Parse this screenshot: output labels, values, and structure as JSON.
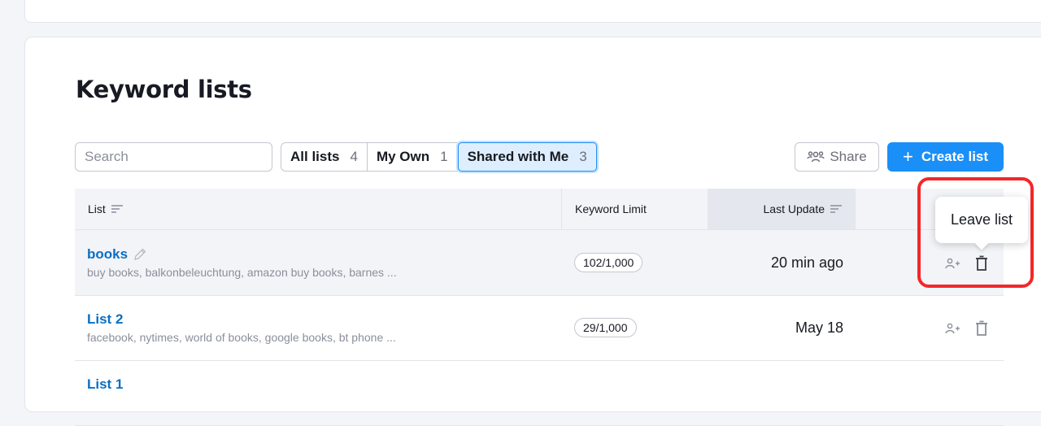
{
  "page": {
    "title": "Keyword lists"
  },
  "search": {
    "placeholder": "Search",
    "value": ""
  },
  "tabs": [
    {
      "label": "All lists",
      "count": "4",
      "active": false
    },
    {
      "label": "My Own",
      "count": "1",
      "active": false
    },
    {
      "label": "Shared with Me",
      "count": "3",
      "active": true
    }
  ],
  "toolbar": {
    "share_label": "Share",
    "create_label": "Create list",
    "create_icon": "+"
  },
  "table": {
    "columns": {
      "list": "List",
      "keyword_limit": "Keyword Limit",
      "last_update": "Last Update"
    },
    "rows": [
      {
        "name": "books",
        "keywords": "buy books, balkonbeleuchtung, amazon buy books, barnes ...",
        "limit": "102/1,000",
        "updated": "20 min ago"
      },
      {
        "name": "List 2",
        "keywords": "facebook, nytimes, world of books, google books, bt phone ...",
        "limit": "29/1,000",
        "updated": "May 18"
      },
      {
        "name": "List 1",
        "keywords": "",
        "limit": "",
        "updated": ""
      }
    ]
  },
  "tooltip": {
    "text": "Leave list"
  },
  "colors": {
    "accent": "#1a8ff7",
    "link": "#0a6fc4",
    "highlight": "#f3272a",
    "active_tab_bg": "#dfeeff"
  },
  "icons": {
    "search": "search-icon",
    "share": "share-users-icon",
    "sort": "sort-icon",
    "edit": "pencil-icon",
    "add_user": "add-user-icon",
    "delete": "trash-icon"
  }
}
